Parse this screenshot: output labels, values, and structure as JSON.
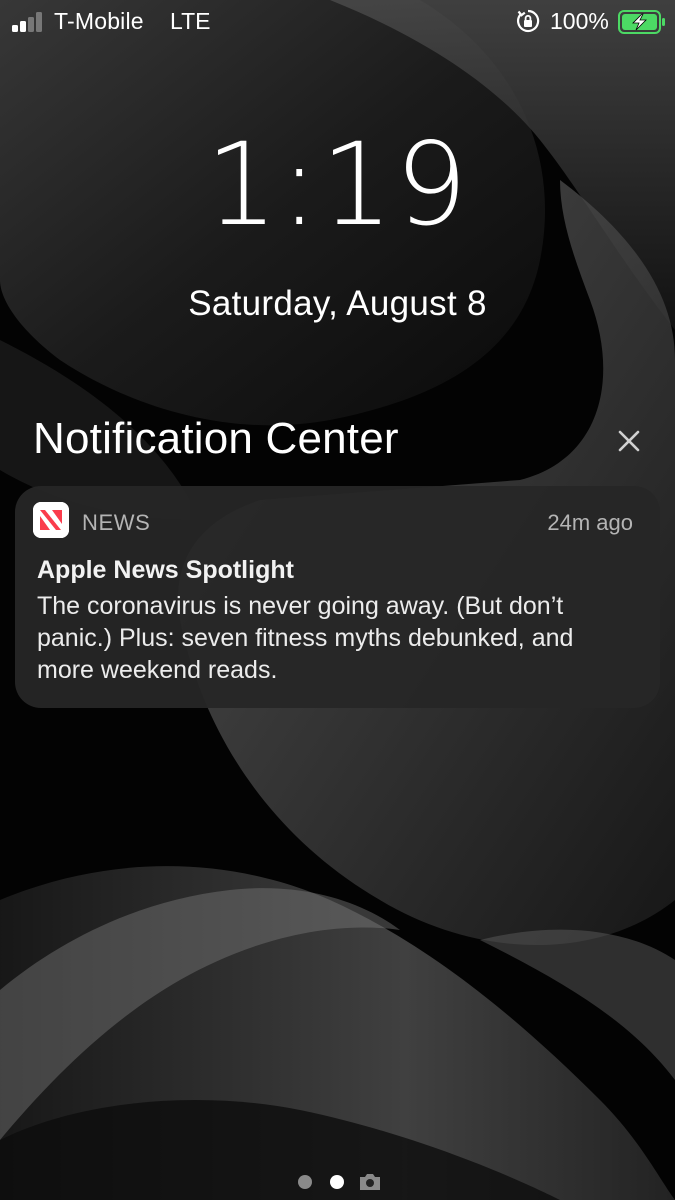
{
  "status_bar": {
    "carrier": "T-Mobile",
    "network": "LTE",
    "battery_percent": "100%",
    "signal_bars_filled": 2,
    "signal_bars_total": 4,
    "battery_level": 1.0,
    "battery_charging": true,
    "icons": [
      "signal-icon",
      "rotation-lock-icon",
      "battery-charging-icon"
    ]
  },
  "lock_screen": {
    "time": "1:19",
    "date": "Saturday, August 8"
  },
  "notification_center": {
    "title": "Notification Center",
    "close_icon": "close-icon"
  },
  "notification": {
    "app_name": "NEWS",
    "time_ago": "24m ago",
    "title": "Apple News Spotlight",
    "body": "The coronavirus is never going away. (But don’t panic.) Plus: seven fitness myths debunked, and more weekend reads.",
    "app_icon": "apple-news-icon"
  },
  "page_indicator": {
    "pages": 2,
    "current_page": 2,
    "extra_icon": "camera-icon"
  },
  "colors": {
    "background": "#000000",
    "text": "#ffffff",
    "secondary_text": "#b4b4b4",
    "card": "#262626",
    "battery_green": "#4cd964",
    "news_red": "#fa3c4c"
  }
}
